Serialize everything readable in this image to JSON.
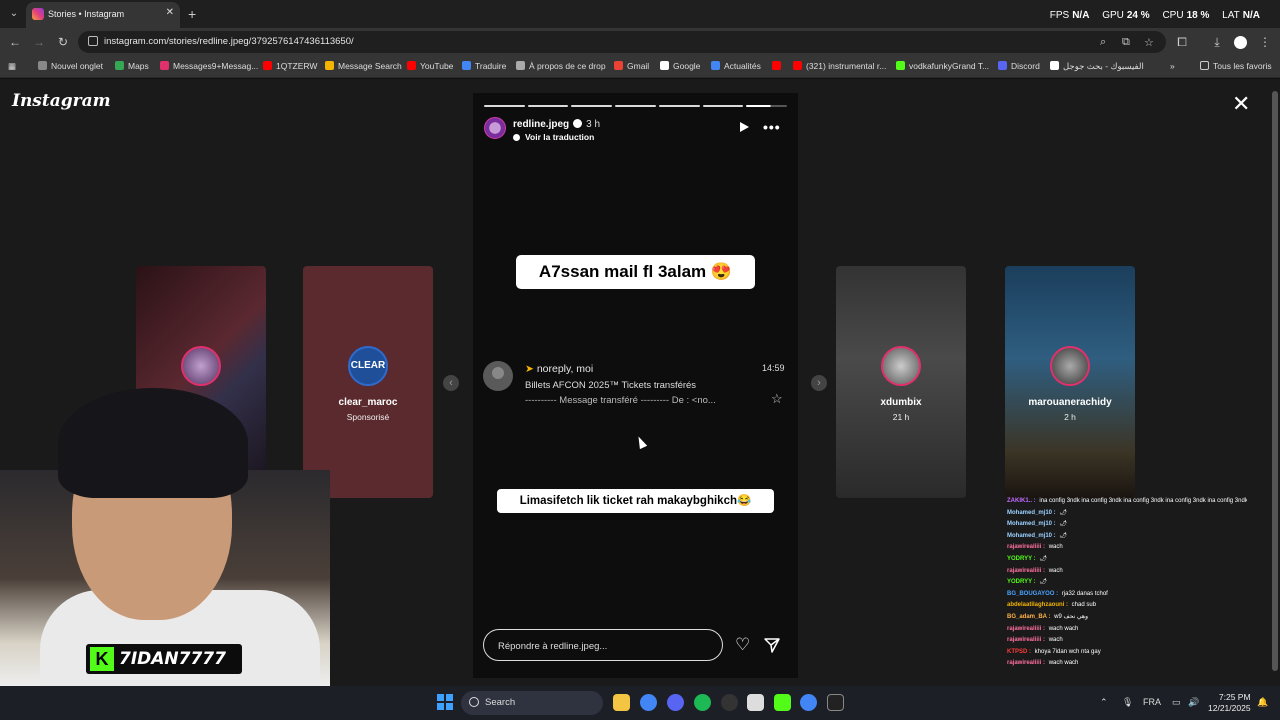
{
  "browser": {
    "tab_title": "Stories • Instagram",
    "url": "instagram.com/stories/redline.jpeg/3792576147436113650/",
    "stats": {
      "fps_label": "FPS",
      "fps": "N/A",
      "gpu_label": "GPU",
      "gpu": "24 %",
      "cpu_label": "CPU",
      "cpu": "18 %",
      "lat_label": "LAT",
      "lat": "N/A"
    },
    "bookmarks": [
      "Nouvel onglet",
      "Maps",
      "Messages9+Messag...",
      "1QTZERW",
      "Message Search",
      "YouTube",
      "Traduire",
      "À propos de ce drop",
      "Gmail",
      "Google",
      "Actualités",
      "",
      "(321) instrumental r...",
      "vodkafunkyGrand T...",
      "Discord",
      "الفيسبوك - بحث جوجل"
    ],
    "all_bookmarks": "Tous les favoris"
  },
  "instagram": {
    "logo": "Instagram",
    "story": {
      "username": "redline.jpeg",
      "time": "3 h",
      "translate": "Voir la traduction",
      "caption_top": "A7ssan mail fl 3alam 😍",
      "email": {
        "from": "noreply, moi",
        "time": "14:59",
        "subject": "Billets AFCON 2025™ Tickets transférés",
        "snippet": "---------- Message transféré --------- De : <no..."
      },
      "caption_bottom": "Limasifetch lik ticket rah makaybghikch😂",
      "reply_placeholder": "Répondre à redline.jpeg..."
    },
    "side_stories": [
      {
        "name": "",
        "sub": ""
      },
      {
        "name": "clear_maroc",
        "sub": "Sponsorisé",
        "avatar_text": "CLEAR"
      },
      {
        "name": "xdumbix",
        "sub": "21 h"
      },
      {
        "name": "marouanerachidy",
        "sub": "2 h"
      }
    ]
  },
  "stream": {
    "name": "7IDAN7777",
    "chat": [
      {
        "user": "ZAKIK1.. :",
        "msg": "ina config 3ndk ina config 3ndk ina config 3ndk ina config 3ndk ina config 3ndk ina config 3ndk",
        "color": "#c569ff"
      },
      {
        "user": "Mohamed_mj10 :",
        "msg": "🌶",
        "color": "#9ad0ff"
      },
      {
        "user": "Mohamed_mj10 :",
        "msg": "🌶",
        "color": "#9ad0ff"
      },
      {
        "user": "Mohamed_mj10 :",
        "msg": "🌶",
        "color": "#9ad0ff"
      },
      {
        "user": "rajawirealiiii :",
        "msg": "wach",
        "color": "#ff6fa0"
      },
      {
        "user": "YODRYY :",
        "msg": "🌶",
        "color": "#53fc18"
      },
      {
        "user": "rajawirealiiii :",
        "msg": "wach",
        "color": "#ff6fa0"
      },
      {
        "user": "YODRYY :",
        "msg": "🌶",
        "color": "#53fc18"
      },
      {
        "user": "BG_BOUGAYOO :",
        "msg": "rja32 danas tchof",
        "color": "#4aa3ff"
      },
      {
        "user": "abdelaatilaghzaouni :",
        "msg": "chad sub",
        "color": "#f4b400"
      },
      {
        "user": "BG_adam_BA :",
        "msg": "w9 وهي نحف",
        "color": "#ffb347"
      },
      {
        "user": "rajawirealiiii :",
        "msg": "wach wach",
        "color": "#ff6fa0"
      },
      {
        "user": "rajawirealiiii :",
        "msg": "wach",
        "color": "#ff6fa0"
      },
      {
        "user": "KTPSD :",
        "msg": "khoya 7idan wch nta gay",
        "color": "#ff3b3b"
      },
      {
        "user": "rajawirealiiii :",
        "msg": "wach wach",
        "color": "#ff6fa0"
      }
    ]
  },
  "taskbar": {
    "search": "Search",
    "lang": "FRA",
    "time": "7:25 PM",
    "date": "12/21/2025"
  }
}
